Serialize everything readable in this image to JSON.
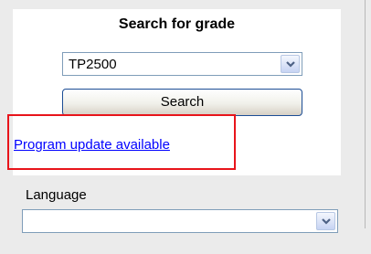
{
  "search_panel": {
    "title": "Search for grade",
    "grade_select": {
      "value": "TP2500",
      "icon": "dropdown-arrow-icon"
    },
    "search_button": "Search",
    "update_link": "Program update available"
  },
  "language": {
    "label": "Language",
    "select": {
      "value": "",
      "icon": "dropdown-arrow-icon"
    }
  },
  "colors": {
    "highlight": "#e8141b",
    "link": "#0000ff"
  }
}
